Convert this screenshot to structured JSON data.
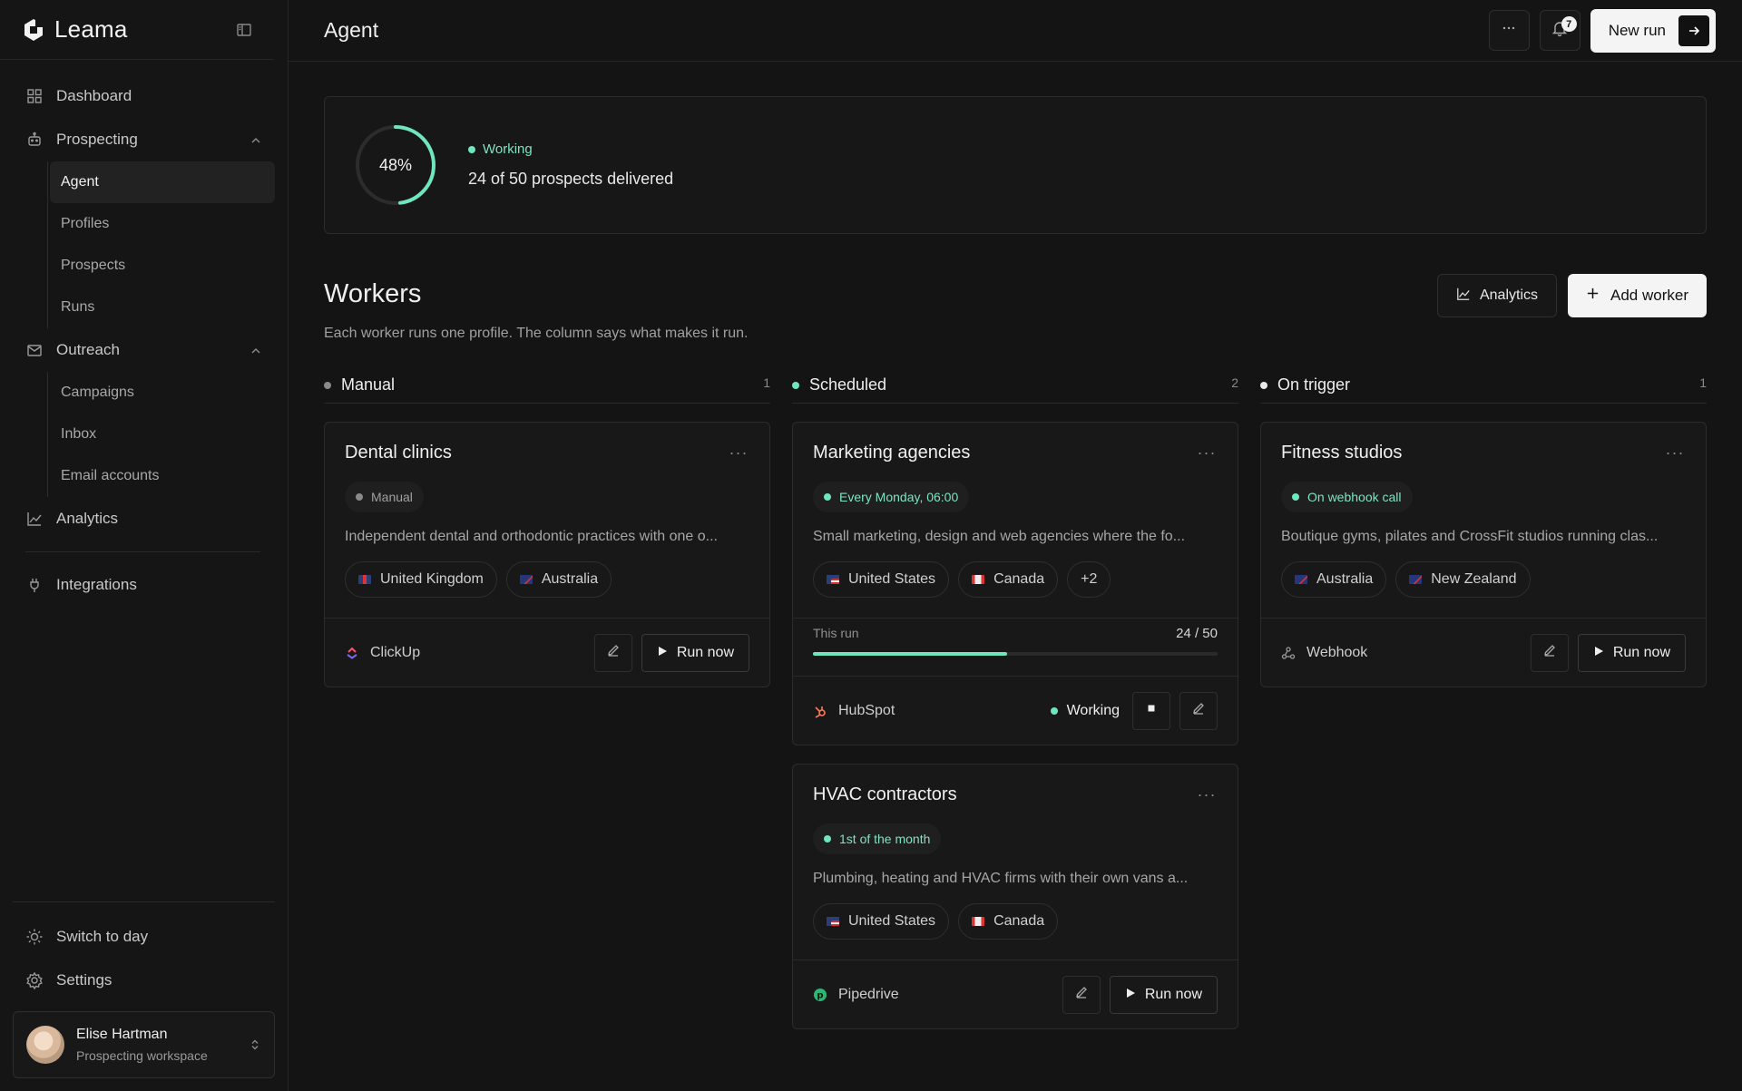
{
  "brand": {
    "name": "Leama"
  },
  "sidebar": {
    "items": [
      {
        "label": "Dashboard",
        "icon": "dashboard-icon"
      },
      {
        "label": "Prospecting",
        "icon": "robot-icon",
        "sub": [
          "Agent",
          "Profiles",
          "Prospects",
          "Runs"
        ]
      },
      {
        "label": "Outreach",
        "icon": "mail-icon",
        "sub": [
          "Campaigns",
          "Inbox",
          "Email accounts"
        ]
      },
      {
        "label": "Analytics",
        "icon": "chart-line-icon"
      },
      {
        "label": "Integrations",
        "icon": "plug-icon"
      }
    ],
    "bottom": {
      "theme_label": "Switch to day",
      "settings_label": "Settings"
    },
    "user": {
      "name": "Elise Hartman",
      "workspace": "Prospecting workspace"
    }
  },
  "topbar": {
    "title": "Agent",
    "notif_count": "7",
    "new_run_label": "New run"
  },
  "status": {
    "percent": 48,
    "percent_label": "48%",
    "state": "Working",
    "summary": "24 of 50 prospects delivered"
  },
  "workers": {
    "title": "Workers",
    "subtitle": "Each worker runs one profile. The column says what makes it run.",
    "analytics_label": "Analytics",
    "add_label": "Add worker",
    "columns": [
      {
        "label": "Manual",
        "count": "1"
      },
      {
        "label": "Scheduled",
        "count": "2"
      },
      {
        "label": "On trigger",
        "count": "1"
      }
    ],
    "cards": {
      "dental": {
        "title": "Dental clinics",
        "chip": "Manual",
        "desc": "Independent dental and orthodontic practices with one o...",
        "tags": [
          "United Kingdom",
          "Australia"
        ],
        "integration": "ClickUp",
        "run_label": "Run now"
      },
      "marketing": {
        "title": "Marketing agencies",
        "chip": "Every Monday, 06:00",
        "desc": "Small marketing, design and web agencies where the fo...",
        "tags": [
          "United States",
          "Canada",
          "+2"
        ],
        "progress_label": "This run",
        "progress_value": "24 / 50",
        "progress_fraction": 0.48,
        "integration": "HubSpot",
        "state": "Working"
      },
      "hvac": {
        "title": "HVAC contractors",
        "chip": "1st of the month",
        "desc": "Plumbing, heating and HVAC firms with their own vans a...",
        "tags": [
          "United States",
          "Canada"
        ],
        "integration": "Pipedrive",
        "run_label": "Run now"
      },
      "fitness": {
        "title": "Fitness studios",
        "chip": "On webhook call",
        "desc": "Boutique gyms, pilates and CrossFit studios running clas...",
        "tags": [
          "Australia",
          "New Zealand"
        ],
        "integration": "Webhook",
        "run_label": "Run now"
      }
    }
  },
  "colors": {
    "accent": "#6fe6bf",
    "background": "#141414"
  }
}
